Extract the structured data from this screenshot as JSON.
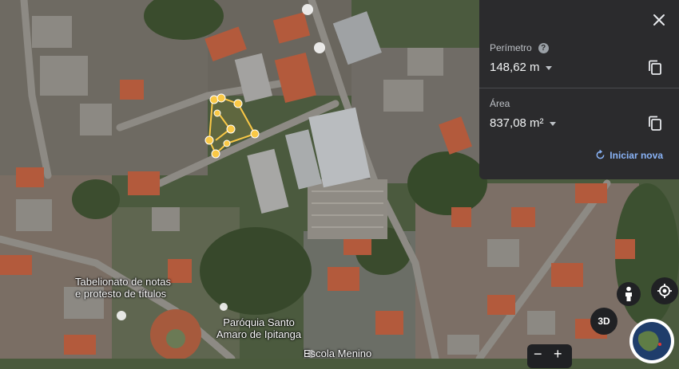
{
  "panel": {
    "perimeter_label": "Perímetro",
    "perimeter_value": "148,62 m",
    "area_label": "Área",
    "area_value": "837,08 m²",
    "restart_label": "Iniciar nova"
  },
  "map_labels": {
    "notary_line1": "Tabelionato de notas",
    "notary_line2": "e protesto de títulos",
    "church_line1": "Paróquia Santo",
    "church_line2": "Amaro de Ipitanga",
    "school": "Escola Menino"
  },
  "controls": {
    "view_3d": "3D",
    "zoom_in": "+",
    "zoom_out": "−"
  },
  "colors": {
    "panel_bg": "#2b2b2d",
    "accent_link": "#8ab4f8",
    "measure_line": "#f9c846"
  },
  "icons": [
    "close-icon",
    "help-icon",
    "copy-icon",
    "refresh-icon",
    "compass-icon",
    "pegman-icon",
    "globe-icon",
    "location-pin-icon"
  ]
}
